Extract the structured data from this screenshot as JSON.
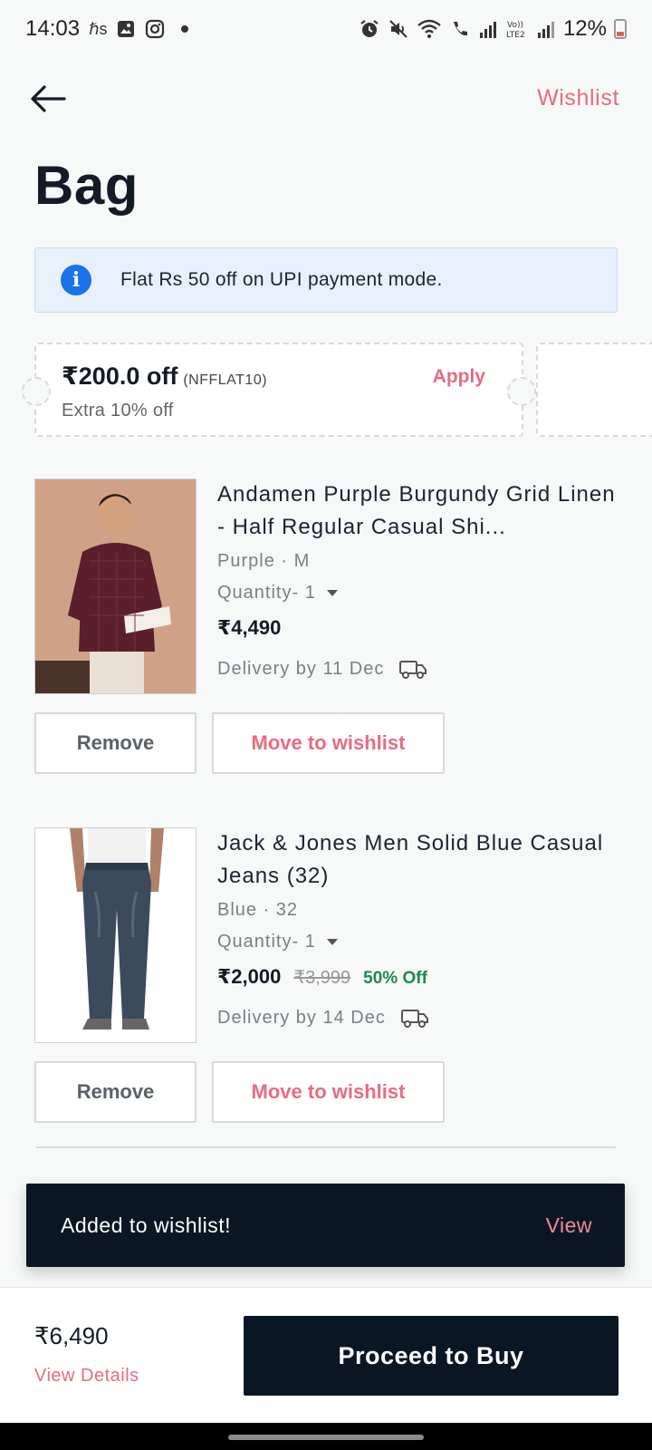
{
  "status_bar": {
    "time": "14:03",
    "battery": "12%",
    "left_icons": [
      "hs-notification-icon",
      "gallery-icon",
      "instagram-icon",
      "dot-icon"
    ],
    "right_icons": [
      "alarm-icon",
      "mute-icon",
      "wifi-icon",
      "wifi-call-icon",
      "signal-1-icon",
      "volte-icon",
      "signal-2-icon"
    ]
  },
  "header": {
    "back_icon": "back-arrow-icon",
    "wishlist_label": "Wishlist"
  },
  "page": {
    "title": "Bag"
  },
  "info_banner": {
    "icon": "info-icon",
    "icon_glyph": "i",
    "text": "Flat Rs 50 off on UPI payment mode."
  },
  "coupon": {
    "amount": "₹200.0 off",
    "code": "(NFFLAT10)",
    "description": "Extra 10% off",
    "apply_label": "Apply"
  },
  "products": [
    {
      "name": "Andamen Purple Burgundy Grid Linen - Half Regular Casual Shi...",
      "variant": "Purple · M",
      "quantity": "Quantity- 1",
      "price": "₹4,490",
      "mrp": "",
      "discount": "",
      "delivery": "Delivery by 11 Dec",
      "remove_label": "Remove",
      "wishlist_label": "Move to wishlist"
    },
    {
      "name": "Jack & Jones Men Solid Blue Casual Jeans (32)",
      "variant": "Blue · 32",
      "quantity": "Quantity- 1",
      "price": "₹2,000",
      "mrp": "₹3,999",
      "discount": "50% Off",
      "delivery": "Delivery by 14 Dec",
      "remove_label": "Remove",
      "wishlist_label": "Move to wishlist"
    }
  ],
  "toast": {
    "text": "Added to wishlist!",
    "action": "View"
  },
  "bottom_bar": {
    "total": "₹6,490",
    "view_details": "View Details",
    "buy_label": "Proceed to Buy"
  },
  "colors": {
    "accent": "#e96b7f",
    "dark": "#0b1624",
    "discount_green": "#1f8a4c",
    "info_blue": "#1a73e8"
  }
}
